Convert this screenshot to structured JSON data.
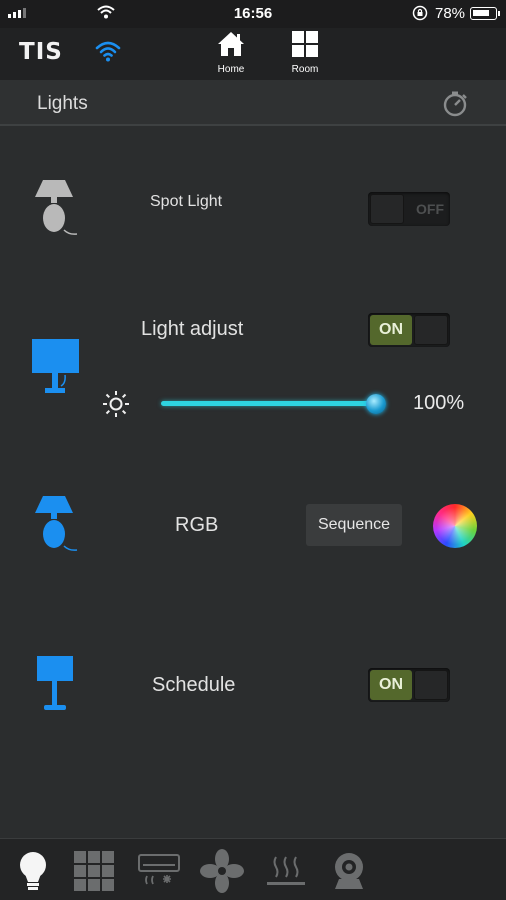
{
  "status_bar": {
    "time": "16:56",
    "battery_text": "78%",
    "battery_level": 0.78
  },
  "top_nav": {
    "logo": "TIS",
    "home_label": "Home",
    "room_label": "Room"
  },
  "header": {
    "title": "Lights",
    "timer_icon": "stopwatch-icon"
  },
  "devices": [
    {
      "name": "Spot Light",
      "icon": "table-lamp-icon",
      "icon_color": "#b9b9b9",
      "toggle_label": "OFF",
      "state": "off"
    },
    {
      "name": "Light adjust",
      "icon": "monitor-lamp-icon",
      "icon_color": "#1b8ff0",
      "toggle_label": "ON",
      "state": "on",
      "brightness_icon": "brightness-icon",
      "brightness_text": "100%",
      "brightness_value": 100
    },
    {
      "name": "RGB",
      "icon": "table-lamp-icon",
      "icon_color": "#1b8ff0",
      "mode_button": "Sequence",
      "color_icon": "color-wheel-icon"
    },
    {
      "name": "Schedule",
      "icon": "floor-lamp-icon",
      "icon_color": "#1b8ff0",
      "toggle_label": "ON",
      "state": "on"
    }
  ],
  "bottom_tabs": [
    "lightbulb-icon",
    "grid-icon",
    "air-conditioner-icon",
    "fan-icon",
    "heating-icon",
    "camera-icon"
  ],
  "colors": {
    "accent_blue": "#1b8ff0",
    "on_green": "#54682c",
    "slider_cyan": "#2ed3e0",
    "background": "#2b2d2e"
  }
}
